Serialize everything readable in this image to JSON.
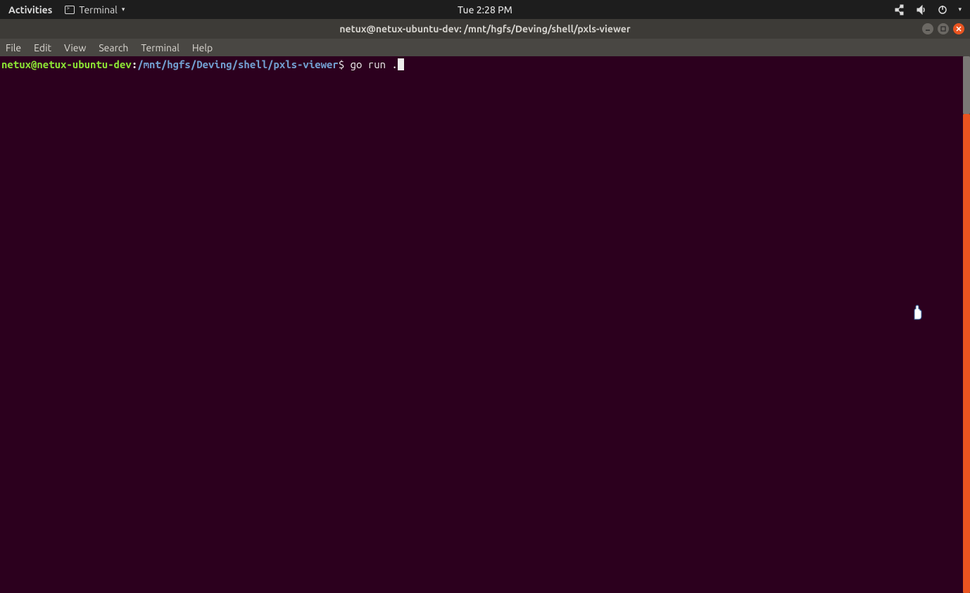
{
  "topbar": {
    "activities": "Activities",
    "app_label": "Terminal",
    "datetime": "Tue  2:28 PM"
  },
  "window": {
    "title": "netux@netux-ubuntu-dev: /mnt/hgfs/Deving/shell/pxls-viewer"
  },
  "menubar": {
    "items": [
      "File",
      "Edit",
      "View",
      "Search",
      "Terminal",
      "Help"
    ]
  },
  "terminal": {
    "prompt_user": "netux@netux-ubuntu-dev",
    "prompt_sep": ":",
    "prompt_path": "/mnt/hgfs/Deving/shell/pxls-viewer",
    "prompt_dollar": "$",
    "command": " go run ."
  }
}
